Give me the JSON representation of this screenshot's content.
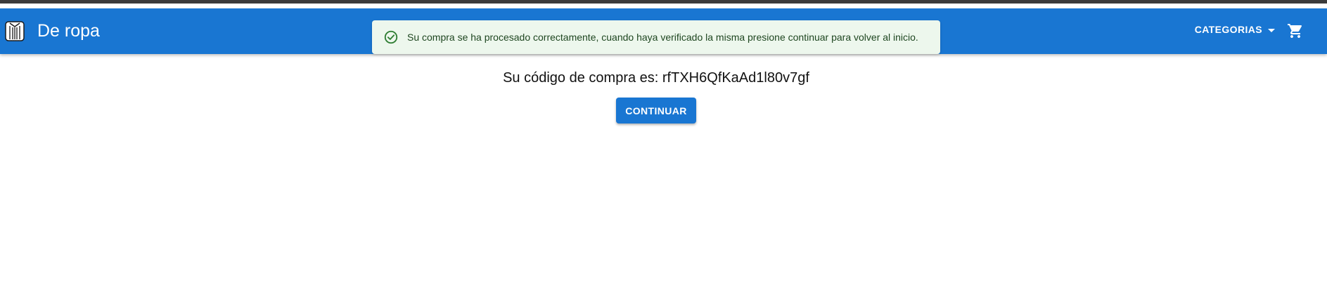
{
  "header": {
    "brand": "De ropa",
    "categories_label": "CATEGORIAS",
    "logo_icon": "shirt-icon",
    "cart_icon": "cart-icon"
  },
  "alert": {
    "icon": "check-circle-icon",
    "message": "Su compra se ha procesado correctamente, cuando haya verificado la misma presione continuar para volver al inicio."
  },
  "main": {
    "code_prefix": "Su código de compra es: ",
    "purchase_code": "rfTXH6QfKaAd1l80v7gf",
    "continue_label": "CONTINUAR"
  },
  "colors": {
    "primary": "#1976d2",
    "alert_bg": "#edf7ed",
    "alert_text": "#1e4620",
    "success_icon": "#2e7d32"
  }
}
